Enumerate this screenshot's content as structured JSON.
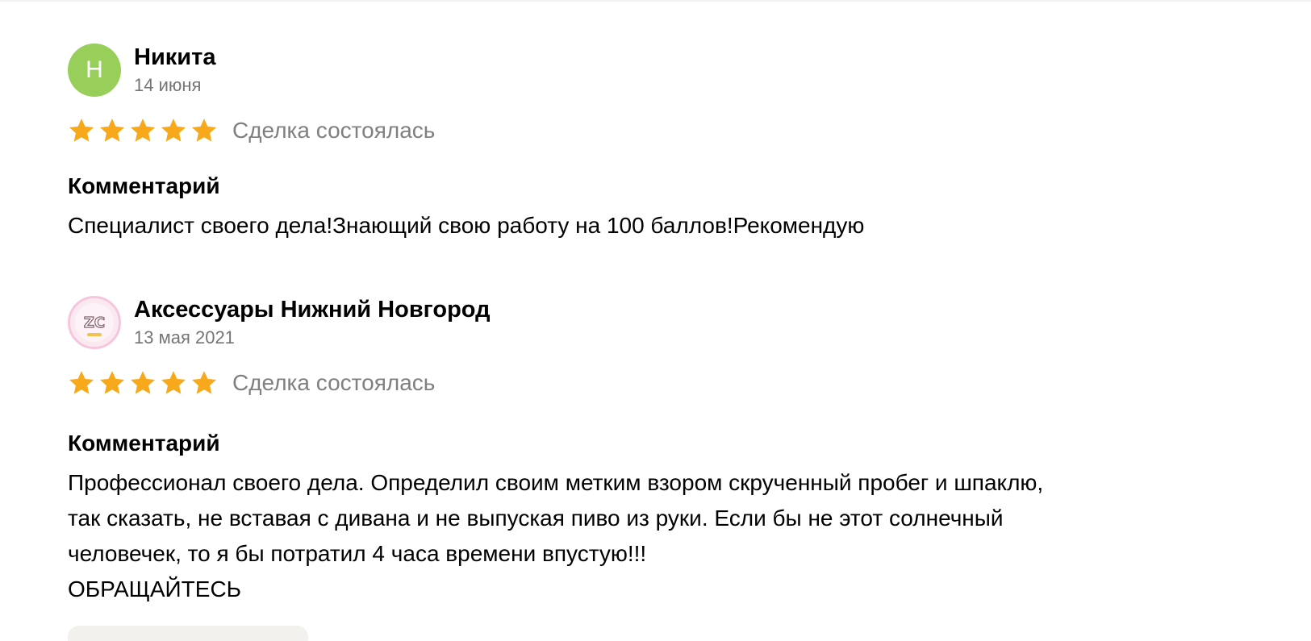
{
  "colors": {
    "star": "#f7a81b",
    "avatar_green": "#97cf5a",
    "muted_text": "#757575"
  },
  "reviews": [
    {
      "avatar": {
        "type": "letter",
        "letter": "Н"
      },
      "author": "Никита",
      "date": "14 июня",
      "rating": 5,
      "deal_status": "Сделка состоялась",
      "comment_heading": "Комментарий",
      "comment": "Специалист своего дела!Знающий свою работу на 100 баллов!Рекомендую"
    },
    {
      "avatar": {
        "type": "logo",
        "logo_text": "ZC"
      },
      "author": "Аксессуары Нижний Новгород",
      "date": "13 мая 2021",
      "rating": 5,
      "deal_status": "Сделка состоялась",
      "comment_heading": "Комментарий",
      "comment": "Профессионал своего дела. Определил своим метким взором скрученный пробег и шпаклю,\nтак сказать, не вставая с дивана и не выпуская пиво из руки. Если бы не этот солнечный\nчеловечек, то я бы потратил 4 часа времени впустую!!!\nОБРАЩАЙТЕСЬ"
    }
  ]
}
